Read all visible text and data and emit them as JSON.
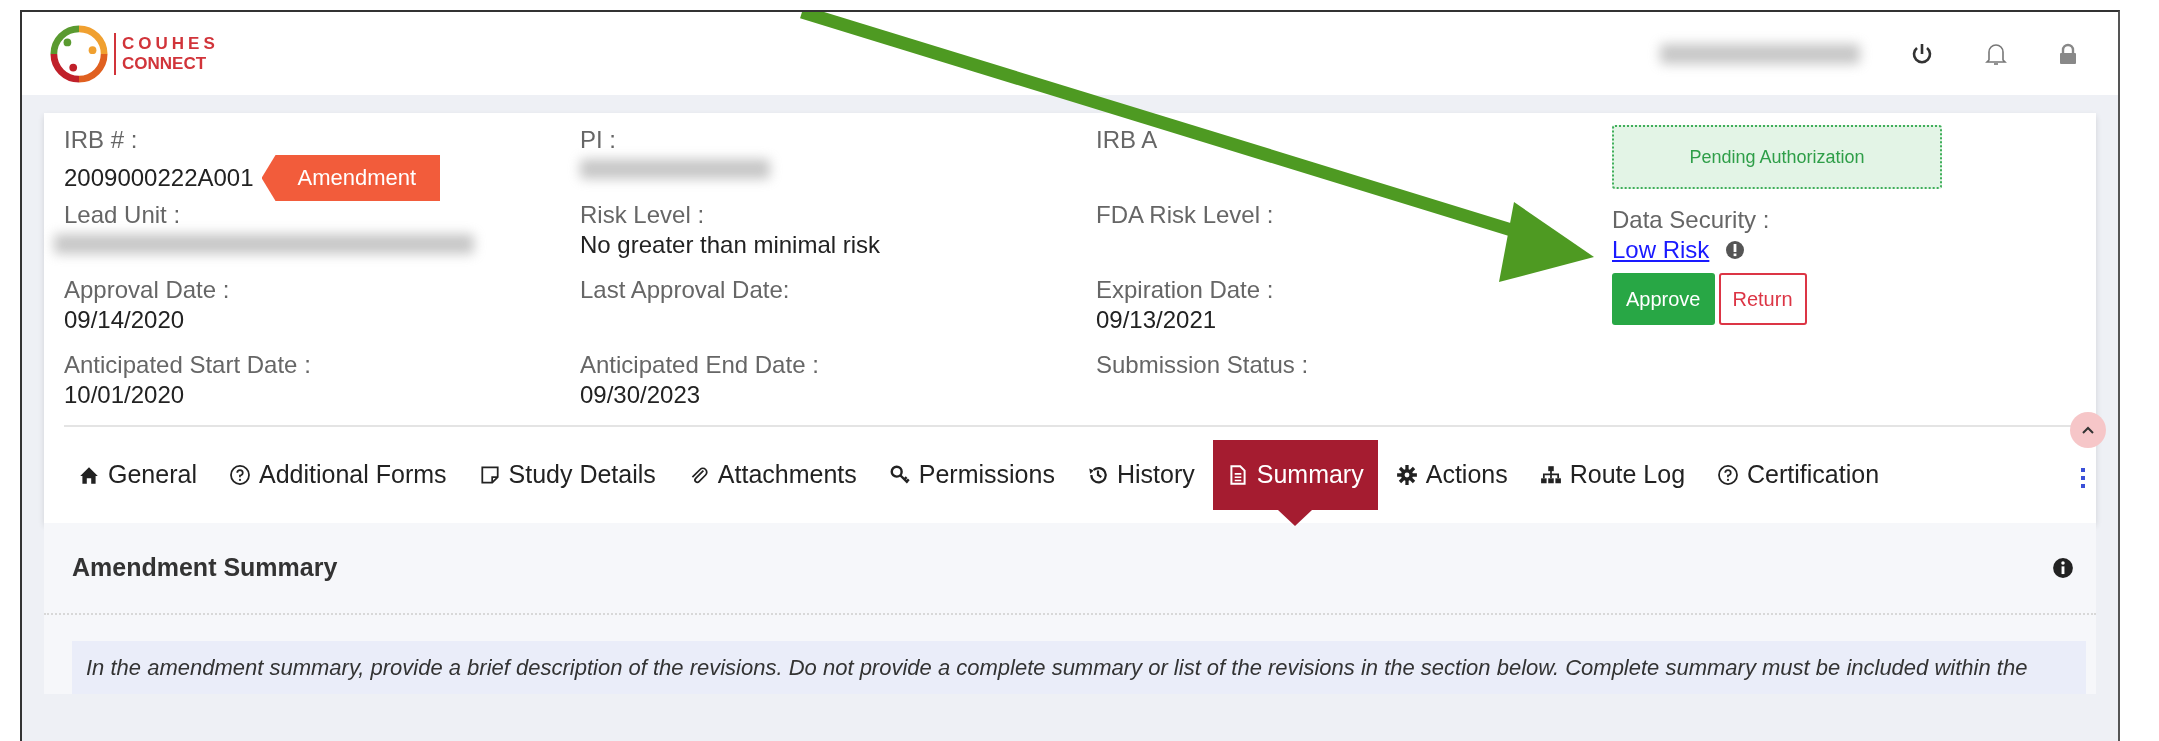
{
  "header": {
    "logo": {
      "line1": "COUHES",
      "line2": "CONNECT"
    },
    "user": {
      "kind": "redacted"
    }
  },
  "record": {
    "columns": [
      [
        {
          "label": "IRB # :",
          "value": "2009000222A001",
          "badge": "Amendment",
          "kind": "text"
        },
        {
          "label": "Lead Unit :",
          "kind": "redacted"
        },
        {
          "label": "Approval Date :",
          "value": "09/14/2020",
          "kind": "text"
        },
        {
          "label": "Anticipated Start Date :",
          "value": "10/01/2020",
          "kind": "text"
        }
      ],
      [
        {
          "label": "PI :",
          "kind": "redacted"
        },
        {
          "label": "Risk Level :",
          "value": "No greater than minimal risk",
          "kind": "text"
        },
        {
          "label": "Last Approval Date:",
          "kind": "empty"
        },
        {
          "label": "Anticipated End Date :",
          "value": "09/30/2023",
          "kind": "text"
        }
      ],
      [
        {
          "label": "IRB A",
          "kind": "empty"
        },
        {
          "label": "FDA Risk Level :",
          "kind": "empty"
        },
        {
          "label": "Expiration Date :",
          "value": "09/13/2021",
          "kind": "text"
        },
        {
          "label": "Submission Status :",
          "kind": "empty"
        }
      ]
    ],
    "status": "Pending Authorization",
    "data_security": {
      "label": "Data Security :",
      "link": "Low Risk"
    },
    "buttons": [
      {
        "label": "Approve",
        "kind": "primary"
      },
      {
        "label": "Return",
        "kind": "outline"
      }
    ]
  },
  "tabs": [
    {
      "label": "General",
      "kind": "home",
      "selected": false
    },
    {
      "label": "Additional Forms",
      "kind": "help",
      "selected": false
    },
    {
      "label": "Study Details",
      "kind": "note",
      "selected": false
    },
    {
      "label": "Attachments",
      "kind": "clip",
      "selected": false
    },
    {
      "label": "Permissions",
      "kind": "key",
      "selected": false
    },
    {
      "label": "History",
      "kind": "history",
      "selected": false
    },
    {
      "label": "Summary",
      "kind": "doc",
      "selected": true
    },
    {
      "label": "Actions",
      "kind": "gear",
      "selected": false
    },
    {
      "label": "Route Log",
      "kind": "tree",
      "selected": false
    },
    {
      "label": "Certification",
      "kind": "help",
      "selected": false
    }
  ],
  "section": {
    "title": "Amendment Summary",
    "instruction": "In the amendment summary, provide a brief description of the revisions. Do not provide a complete summary or list of the revisions in the section below. Complete summary must be included within the"
  }
}
